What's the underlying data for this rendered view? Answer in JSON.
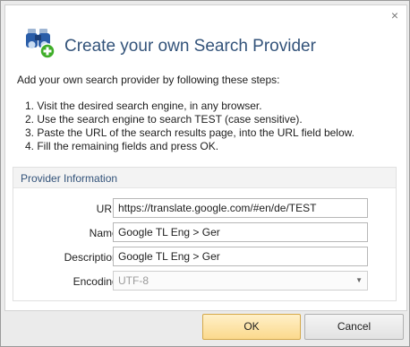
{
  "dialog": {
    "title": "Create your own Search Provider",
    "intro": "Add your own search provider by following these steps:",
    "steps": [
      "1. Visit the desired search engine, in any browser.",
      "2. Use the search engine to search TEST (case sensitive).",
      "3. Paste the URL of the search results page, into the URL field below.",
      "4. Fill the remaining fields and press OK."
    ],
    "icons": {
      "header": "binoculars-add-icon",
      "close": "close-icon"
    }
  },
  "provider": {
    "section_title": "Provider Information",
    "url_label": "URL:",
    "url_value": "https://translate.google.com/#en/de/TEST",
    "name_label": "Name:",
    "name_value": "Google TL Eng > Ger",
    "description_label": "Description:",
    "description_value": "Google TL Eng > Ger",
    "encoding_label": "Encoding:",
    "encoding_value": "UTF-8"
  },
  "buttons": {
    "ok": "OK",
    "cancel": "Cancel"
  },
  "colors": {
    "title": "#33537a",
    "ok_button": "#fbd98c",
    "badge_green": "#3fae29",
    "icon_blue": "#2a5da8"
  }
}
